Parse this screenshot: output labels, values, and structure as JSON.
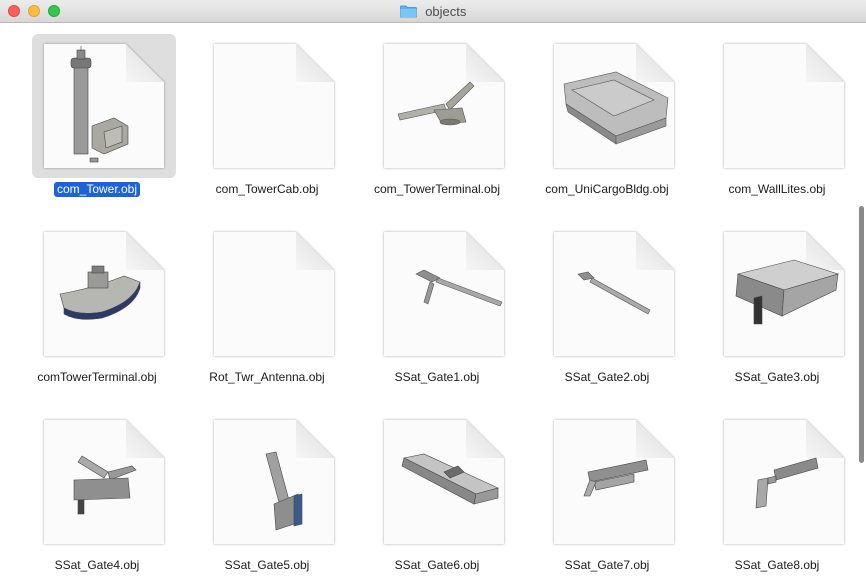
{
  "window": {
    "title": "objects",
    "title_icon": "folder-icon",
    "controls": [
      "close",
      "minimize",
      "zoom"
    ]
  },
  "files": [
    {
      "name": "com_Tower.obj",
      "preview": "tower",
      "selected": true
    },
    {
      "name": "com_TowerCab.obj",
      "preview": "blank",
      "selected": false
    },
    {
      "name": "com_TowerTerminal.obj",
      "preview": "terminal-wing",
      "selected": false
    },
    {
      "name": "com_UniCargoBldg.obj",
      "preview": "cargo-building",
      "selected": false
    },
    {
      "name": "com_WallLites.obj",
      "preview": "blank",
      "selected": false
    },
    {
      "name": "comTowerTerminal.obj",
      "preview": "terminal-curve",
      "selected": false
    },
    {
      "name": "Rot_Twr_Antenna.obj",
      "preview": "blank",
      "selected": false
    },
    {
      "name": "SSat_Gate1.obj",
      "preview": "gate-long",
      "selected": false
    },
    {
      "name": "SSat_Gate2.obj",
      "preview": "gate-thin",
      "selected": false
    },
    {
      "name": "SSat_Gate3.obj",
      "preview": "gate-block",
      "selected": false
    },
    {
      "name": "SSat_Gate4.obj",
      "preview": "gate-v",
      "selected": false
    },
    {
      "name": "SSat_Gate5.obj",
      "preview": "gate-l",
      "selected": false
    },
    {
      "name": "SSat_Gate6.obj",
      "preview": "gate-wide",
      "selected": false
    },
    {
      "name": "SSat_Gate7.obj",
      "preview": "gate-diag",
      "selected": false
    },
    {
      "name": "SSat_Gate8.obj",
      "preview": "gate-bend",
      "selected": false
    }
  ]
}
